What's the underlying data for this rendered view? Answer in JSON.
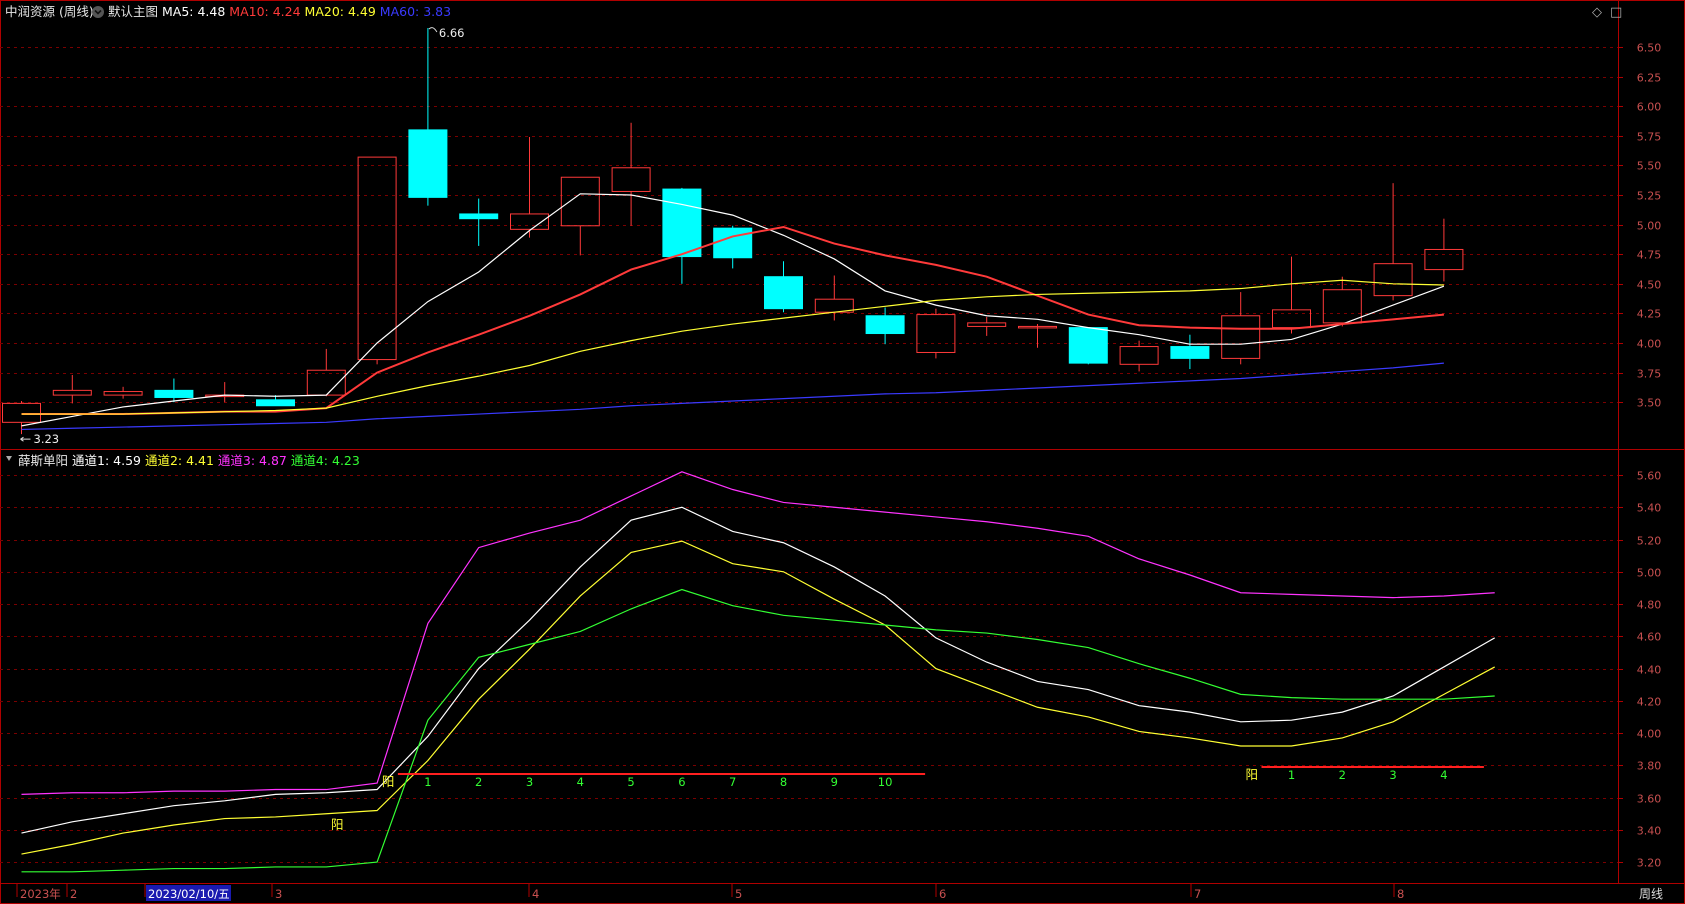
{
  "header": {
    "stock_name": "中润资源 (周线)",
    "main_label": "默认主图",
    "ma": [
      {
        "label": "MA5:",
        "value": "4.48",
        "color": "#ffffff"
      },
      {
        "label": "MA10:",
        "value": "4.24",
        "color": "#ff3a3a"
      },
      {
        "label": "MA20:",
        "value": "4.49",
        "color": "#ffff33"
      },
      {
        "label": "MA60:",
        "value": "3.83",
        "color": "#3a3aff"
      }
    ]
  },
  "sub_header": {
    "name": "薛斯单阳",
    "channels": [
      {
        "label": "通道1:",
        "value": "4.59",
        "color": "#ffffff"
      },
      {
        "label": "通道2:",
        "value": "4.41",
        "color": "#ffff33"
      },
      {
        "label": "通道3:",
        "value": "4.87",
        "color": "#ff33ff"
      },
      {
        "label": "通道4:",
        "value": "4.23",
        "color": "#33ff33"
      }
    ]
  },
  "controls": {
    "diamond": "◇",
    "maximize": "□"
  },
  "axis": {
    "x_labels": [
      "2023年",
      "2",
      "2023/02/10/五",
      "3",
      "4",
      "5",
      "6",
      "7",
      "8"
    ],
    "period": "周线"
  },
  "colors": {
    "up": "#ff3a3a",
    "down": "#00ffff",
    "grid": "#7a0000",
    "axis": "#b00000",
    "signal": "#ffff33",
    "count": "#33ff33"
  },
  "chart_data": [
    {
      "type": "candlestick",
      "title": "中润资源 (周线)",
      "ylim": [
        3.23,
        6.66
      ],
      "y_ticks": [
        "6.50",
        "6.25",
        "6.00",
        "5.75",
        "5.50",
        "5.25",
        "5.00",
        "4.75",
        "4.50",
        "4.25",
        "4.00",
        "3.75",
        "3.50"
      ],
      "annotations": [
        {
          "label": "6.66",
          "value": 6.66
        },
        {
          "label": "3.23",
          "value": 3.23
        }
      ],
      "candles": [
        {
          "o": 3.33,
          "h": 3.51,
          "l": 3.23,
          "c": 3.49
        },
        {
          "o": 3.56,
          "h": 3.73,
          "l": 3.49,
          "c": 3.6
        },
        {
          "o": 3.56,
          "h": 3.63,
          "l": 3.53,
          "c": 3.59
        },
        {
          "o": 3.6,
          "h": 3.7,
          "l": 3.5,
          "c": 3.54
        },
        {
          "o": 3.56,
          "h": 3.67,
          "l": 3.5,
          "c": 3.56
        },
        {
          "o": 3.52,
          "h": 3.56,
          "l": 3.47,
          "c": 3.47
        },
        {
          "o": 3.56,
          "h": 3.95,
          "l": 3.55,
          "c": 3.77
        },
        {
          "o": 3.86,
          "h": 5.57,
          "l": 3.82,
          "c": 5.57
        },
        {
          "o": 5.8,
          "h": 6.66,
          "l": 5.16,
          "c": 5.23
        },
        {
          "o": 5.09,
          "h": 5.22,
          "l": 4.82,
          "c": 5.05
        },
        {
          "o": 4.96,
          "h": 5.74,
          "l": 4.89,
          "c": 5.09
        },
        {
          "o": 4.99,
          "h": 5.4,
          "l": 4.74,
          "c": 5.4
        },
        {
          "o": 5.28,
          "h": 5.86,
          "l": 4.99,
          "c": 5.48
        },
        {
          "o": 5.3,
          "h": 5.31,
          "l": 4.5,
          "c": 4.73
        },
        {
          "o": 4.97,
          "h": 4.99,
          "l": 4.63,
          "c": 4.72
        },
        {
          "o": 4.56,
          "h": 4.69,
          "l": 4.26,
          "c": 4.29
        },
        {
          "o": 4.26,
          "h": 4.57,
          "l": 4.19,
          "c": 4.37
        },
        {
          "o": 4.23,
          "h": 4.3,
          "l": 3.99,
          "c": 4.08
        },
        {
          "o": 3.92,
          "h": 4.29,
          "l": 3.87,
          "c": 4.24
        },
        {
          "o": 4.14,
          "h": 4.22,
          "l": 4.06,
          "c": 4.17
        },
        {
          "o": 4.14,
          "h": 4.16,
          "l": 3.96,
          "c": 4.14
        },
        {
          "o": 4.13,
          "h": 4.13,
          "l": 3.82,
          "c": 3.83
        },
        {
          "o": 3.82,
          "h": 4.02,
          "l": 3.76,
          "c": 3.97
        },
        {
          "o": 3.97,
          "h": 4.07,
          "l": 3.78,
          "c": 3.87
        },
        {
          "o": 3.87,
          "h": 4.43,
          "l": 3.82,
          "c": 4.23
        },
        {
          "o": 4.13,
          "h": 4.73,
          "l": 4.08,
          "c": 4.28
        },
        {
          "o": 4.17,
          "h": 4.56,
          "l": 4.14,
          "c": 4.45
        },
        {
          "o": 4.4,
          "h": 5.35,
          "l": 4.36,
          "c": 4.67
        },
        {
          "o": 4.62,
          "h": 5.05,
          "l": 4.52,
          "c": 4.79
        }
      ],
      "series": [
        {
          "name": "MA5",
          "color": "#ffffff",
          "values": [
            3.3,
            3.38,
            3.46,
            3.51,
            3.56,
            3.55,
            3.56,
            4.0,
            4.35,
            4.6,
            4.95,
            5.26,
            5.25,
            5.17,
            5.08,
            4.91,
            4.71,
            4.44,
            4.32,
            4.23,
            4.2,
            4.13,
            4.07,
            3.99,
            3.99,
            4.03,
            4.16,
            4.32,
            4.48
          ]
        },
        {
          "name": "MA10",
          "color": "#ff3a3a",
          "values": [
            3.4,
            3.4,
            3.4,
            3.41,
            3.42,
            3.42,
            3.45,
            3.75,
            3.92,
            4.07,
            4.23,
            4.41,
            4.62,
            4.75,
            4.9,
            4.98,
            4.84,
            4.74,
            4.66,
            4.56,
            4.4,
            4.24,
            4.15,
            4.13,
            4.12,
            4.12,
            4.16,
            4.2,
            4.24
          ]
        },
        {
          "name": "MA20",
          "color": "#ffff33",
          "values": [
            3.4,
            3.4,
            3.4,
            3.41,
            3.42,
            3.43,
            3.45,
            3.55,
            3.64,
            3.72,
            3.81,
            3.93,
            4.02,
            4.1,
            4.16,
            4.21,
            4.26,
            4.31,
            4.36,
            4.39,
            4.41,
            4.42,
            4.43,
            4.44,
            4.46,
            4.5,
            4.53,
            4.5,
            4.49
          ]
        },
        {
          "name": "MA60",
          "color": "#3a3aff",
          "values": [
            3.27,
            3.28,
            3.29,
            3.3,
            3.31,
            3.32,
            3.33,
            3.36,
            3.38,
            3.4,
            3.42,
            3.44,
            3.47,
            3.49,
            3.51,
            3.53,
            3.55,
            3.57,
            3.58,
            3.6,
            3.62,
            3.64,
            3.66,
            3.68,
            3.7,
            3.73,
            3.76,
            3.79,
            3.83
          ]
        }
      ]
    },
    {
      "type": "line",
      "title": "薛斯单阳",
      "ylim": [
        3.11,
        5.67
      ],
      "y_ticks": [
        "5.60",
        "5.40",
        "5.20",
        "5.00",
        "4.80",
        "4.60",
        "4.40",
        "4.20",
        "4.00",
        "3.80",
        "3.60",
        "3.40",
        "3.20"
      ],
      "series": [
        {
          "name": "通道1",
          "color": "#ffffff",
          "values": [
            3.38,
            3.45,
            3.5,
            3.55,
            3.58,
            3.62,
            3.63,
            3.65,
            3.98,
            4.4,
            4.7,
            5.03,
            5.32,
            5.4,
            5.25,
            5.18,
            5.03,
            4.85,
            4.59,
            4.44,
            4.32,
            4.27,
            4.17,
            4.13,
            4.07,
            4.08,
            4.13,
            4.23,
            4.41,
            4.59
          ]
        },
        {
          "name": "通道2",
          "color": "#ffff33",
          "values": [
            3.25,
            3.31,
            3.38,
            3.43,
            3.47,
            3.48,
            3.5,
            3.52,
            3.83,
            4.21,
            4.52,
            4.85,
            5.12,
            5.19,
            5.05,
            5.0,
            4.83,
            4.67,
            4.4,
            4.28,
            4.16,
            4.1,
            4.01,
            3.97,
            3.92,
            3.92,
            3.97,
            4.07,
            4.24,
            4.41
          ]
        },
        {
          "name": "通道3",
          "color": "#ff33ff",
          "values": [
            3.62,
            3.63,
            3.63,
            3.64,
            3.64,
            3.65,
            3.65,
            3.69,
            4.68,
            5.15,
            5.24,
            5.32,
            5.47,
            5.62,
            5.51,
            5.43,
            5.4,
            5.37,
            5.34,
            5.31,
            5.27,
            5.22,
            5.08,
            4.98,
            4.87,
            4.86,
            4.85,
            4.84,
            4.85,
            4.87
          ]
        },
        {
          "name": "通道4",
          "color": "#33ff33",
          "values": [
            3.14,
            3.14,
            3.15,
            3.16,
            3.16,
            3.17,
            3.17,
            3.2,
            4.08,
            4.47,
            4.55,
            4.63,
            4.77,
            4.89,
            4.79,
            4.73,
            4.7,
            4.67,
            4.64,
            4.62,
            4.58,
            4.53,
            4.43,
            4.34,
            4.24,
            4.22,
            4.21,
            4.21,
            4.21,
            4.23
          ]
        }
      ],
      "signals": [
        {
          "label": "阳",
          "bar": 6
        },
        {
          "label": "阳",
          "bar": 7
        },
        {
          "label": "阳",
          "bar": 24
        }
      ],
      "counts": [
        {
          "labels": [
            "1",
            "2",
            "3",
            "4",
            "5",
            "6",
            "7",
            "8",
            "9",
            "10"
          ],
          "start_bar": 8
        },
        {
          "labels": [
            "1",
            "2",
            "3",
            "4"
          ],
          "start_bar": 25
        }
      ]
    }
  ]
}
